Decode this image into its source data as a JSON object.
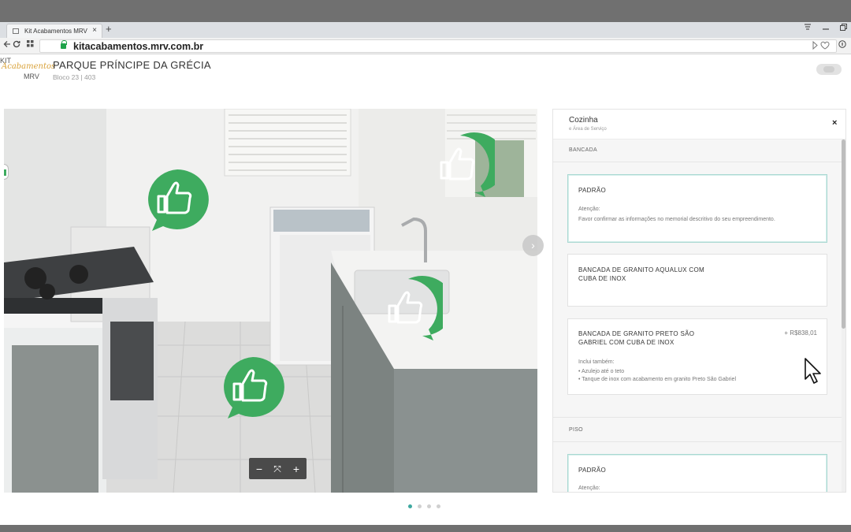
{
  "browser": {
    "tab_title": "Kit Acabamentos MRV",
    "tab_close": "×",
    "new_tab": "+",
    "url": "kitacabamentos.mrv.com.br"
  },
  "header": {
    "logo_kit": "KIT",
    "logo_script": "Acabamentos",
    "logo_mrv": "MRV",
    "project_title": "PARQUE PRÍNCIPE DA GRÉCIA",
    "project_subtitle": "Bloco 23 | 403"
  },
  "viewer": {
    "hotspots": [
      "thumbs-up",
      "thumbs-up",
      "thumbs-up",
      "thumbs-up"
    ],
    "next_arrow": "›",
    "zoom_out": "−",
    "fullscreen": "⤧",
    "zoom_in": "+",
    "hotspot_color": "#3eab5f",
    "pagination": {
      "count": 4,
      "active": 0
    }
  },
  "panel": {
    "room": "Cozinha",
    "room_sub": "e Área de Serviço",
    "close": "×",
    "sections": [
      {
        "label": "BANCADA",
        "options": [
          {
            "title": "PADRÃO",
            "note_label": "Atenção:",
            "note": "Favor confirmar as informações no memorial descritivo do seu empreendimento.",
            "selected": true
          },
          {
            "title_line1": "BANCADA DE GRANITO AQUALUX COM",
            "title_line2": "CUBA DE INOX"
          },
          {
            "title_line1": "BANCADA DE GRANITO PRETO SÃO",
            "title_line2": "GABRIEL COM CUBA DE INOX",
            "price": "+ R$838,01",
            "includes_label": "Inclui também:",
            "includes": [
              "• Azulejo até o teto",
              "• Tanque de inox com acabamento em granito Preto São Gabriel"
            ]
          }
        ]
      },
      {
        "label": "PISO",
        "options": [
          {
            "title": "PADRÃO",
            "note_label": "Atenção:"
          }
        ]
      }
    ]
  }
}
